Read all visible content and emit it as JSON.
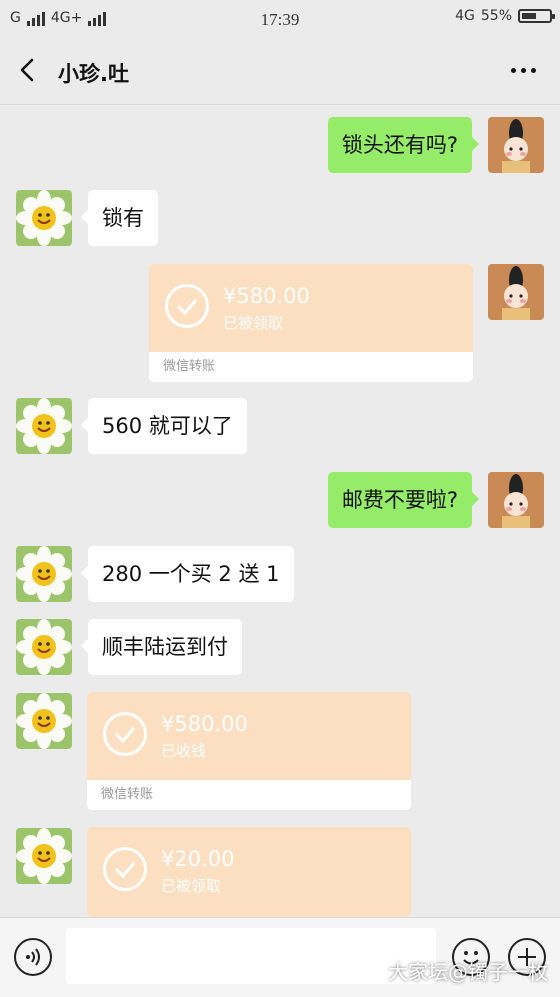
{
  "status": {
    "left": "G",
    "network": "4G+",
    "time": "17:39",
    "network_right": "4G",
    "battery": "55%",
    "battery_level": 0.55
  },
  "header": {
    "title": "小珍.吐"
  },
  "messages": [
    {
      "side": "out",
      "text": "锁头还有吗?"
    },
    {
      "side": "in",
      "text": "锁有"
    },
    {
      "side": "out",
      "type": "transfer",
      "amount": "¥580.00",
      "status": "已被领取",
      "footer": "微信转账"
    },
    {
      "side": "in",
      "text": "560 就可以了"
    },
    {
      "side": "out",
      "text": "邮费不要啦?"
    },
    {
      "side": "in",
      "text": "280 一个买 2 送 1"
    },
    {
      "side": "in",
      "text": "顺丰陆运到付"
    },
    {
      "side": "in",
      "type": "transfer",
      "amount": "¥580.00",
      "status": "已收钱",
      "footer": "微信转账"
    },
    {
      "side": "in",
      "type": "transfer",
      "amount": "¥20.00",
      "status": "已被领取",
      "footer": ""
    }
  ],
  "watermark": "大家坛@镯子一枚",
  "colors": {
    "out_bubble": "#95ec69",
    "transfer": "#fbdfc0",
    "background": "#ebebeb"
  }
}
